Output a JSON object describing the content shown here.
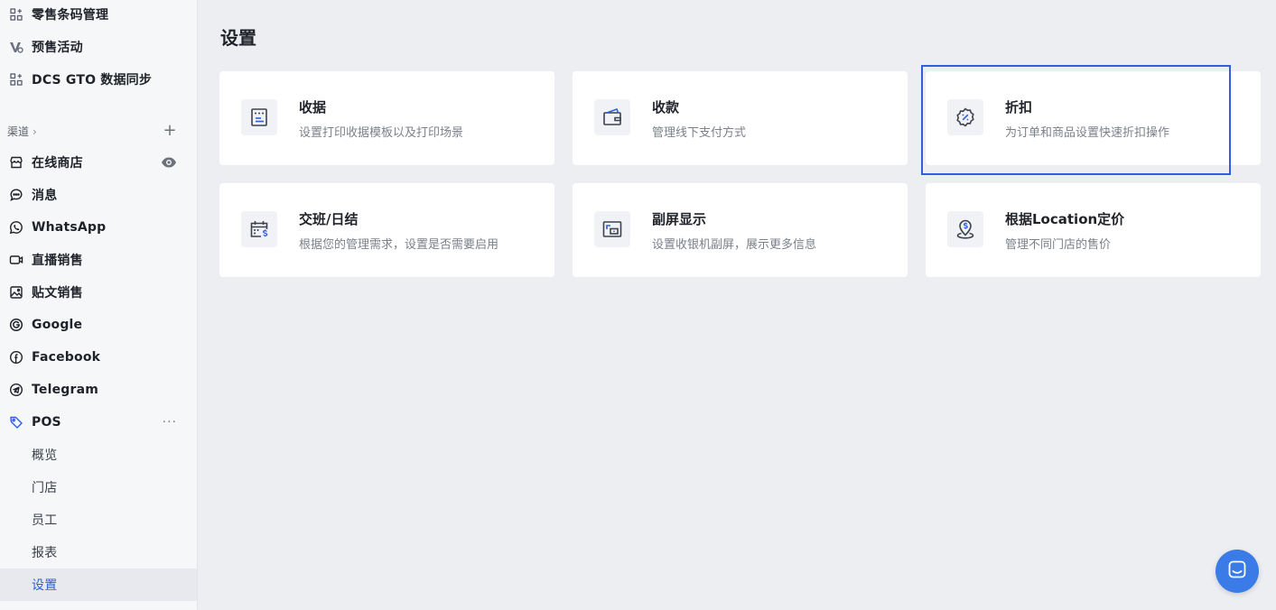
{
  "sidebar": {
    "top_items": [
      {
        "label": "零售条码管理",
        "icon": "grid-plus-icon"
      },
      {
        "label": "预售活动",
        "icon": "presale-icon"
      },
      {
        "label": "DCS GTO 数据同步",
        "icon": "grid-plus-icon"
      }
    ],
    "channels_label": "渠道",
    "channels_chevron": "›",
    "add_glyph": "+",
    "channels": [
      {
        "label": "在线商店",
        "icon": "store-icon"
      },
      {
        "label": "消息",
        "icon": "chat-bubble-icon"
      },
      {
        "label": "WhatsApp",
        "icon": "whatsapp-icon"
      },
      {
        "label": "直播销售",
        "icon": "video-camera-icon"
      },
      {
        "label": "贴文销售",
        "icon": "image-post-icon"
      },
      {
        "label": "Google",
        "icon": "google-icon"
      },
      {
        "label": "Facebook",
        "icon": "facebook-icon"
      },
      {
        "label": "Telegram",
        "icon": "telegram-icon"
      },
      {
        "label": "POS",
        "icon": "pos-tag-icon"
      }
    ],
    "more_glyph": "···",
    "pos_sub": [
      {
        "label": "概览"
      },
      {
        "label": "门店"
      },
      {
        "label": "员工"
      },
      {
        "label": "报表"
      },
      {
        "label": "设置",
        "active": true
      }
    ]
  },
  "main": {
    "title": "设置",
    "cards": [
      {
        "title": "收据",
        "desc": "设置打印收据模板以及打印场景",
        "icon": "receipt-icon"
      },
      {
        "title": "收款",
        "desc": "管理线下支付方式",
        "icon": "wallet-icon"
      },
      {
        "title": "折扣",
        "desc": "为订单和商品设置快速折扣操作",
        "icon": "discount-badge-icon"
      },
      {
        "title": "交班/日结",
        "desc": "根据您的管理需求，设置是否需要启用",
        "icon": "calendar-dollar-icon"
      },
      {
        "title": "副屏显示",
        "desc": "设置收银机副屏，展示更多信息",
        "icon": "second-screen-icon"
      },
      {
        "title": "根据Location定价",
        "desc": "管理不同门店的售价",
        "icon": "location-price-icon"
      }
    ]
  },
  "colors": {
    "accent": "#2b5fd9",
    "focus_ring": "#2f5ee0",
    "chat_button": "#3b7be8",
    "background": "#eceef2",
    "card": "#ffffff"
  }
}
